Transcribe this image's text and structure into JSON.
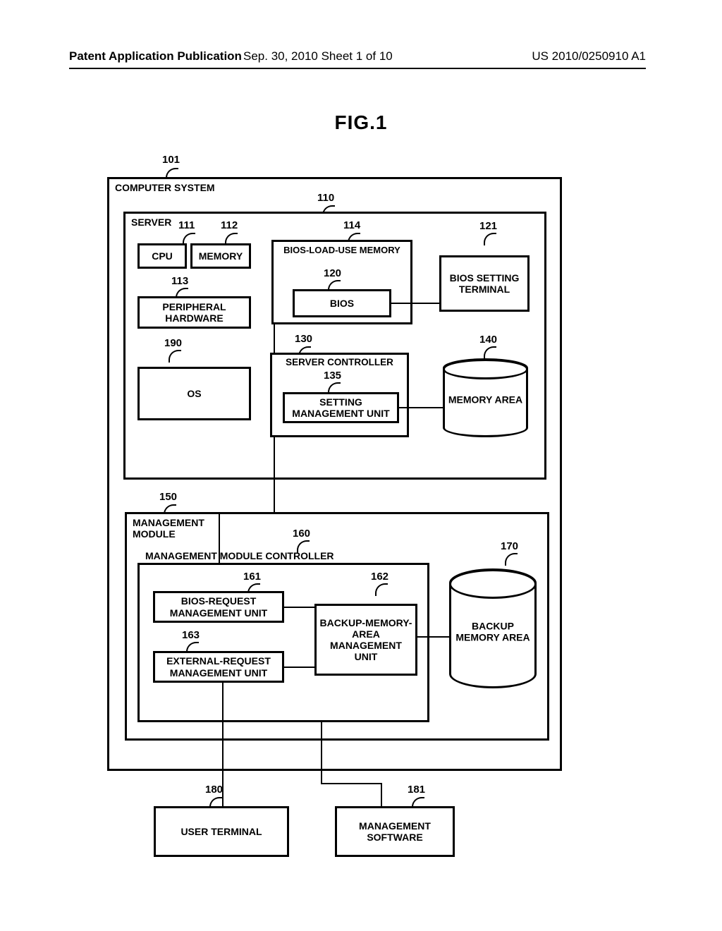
{
  "header": {
    "left": "Patent Application Publication",
    "mid": "Sep. 30, 2010  Sheet 1 of 10",
    "right": "US 2010/0250910 A1"
  },
  "figure_title": "FIG.1",
  "refs": {
    "r101": "101",
    "r110": "110",
    "r111": "111",
    "r112": "112",
    "r113": "113",
    "r114": "114",
    "r120": "120",
    "r121": "121",
    "r130": "130",
    "r135": "135",
    "r140": "140",
    "r150": "150",
    "r160": "160",
    "r161": "161",
    "r162": "162",
    "r163": "163",
    "r170": "170",
    "r180": "180",
    "r181": "181",
    "r190": "190"
  },
  "labels": {
    "computer_system": "COMPUTER SYSTEM",
    "server": "SERVER",
    "cpu": "CPU",
    "memory": "MEMORY",
    "peripheral_hw": "PERIPHERAL HARDWARE",
    "os": "OS",
    "bios_load_mem": "BIOS-LOAD-USE MEMORY",
    "bios": "BIOS",
    "bios_setting_terminal": "BIOS SETTING TERMINAL",
    "server_controller": "SERVER CONTROLLER",
    "setting_mgmt": "SETTING MANAGEMENT UNIT",
    "memory_area": "MEMORY AREA",
    "mgmt_module": "MANAGEMENT MODULE",
    "mmc": "MANAGEMENT MODULE CONTROLLER",
    "bios_req_mgmt": "BIOS-REQUEST MANAGEMENT UNIT",
    "ext_req_mgmt": "EXTERNAL-REQUEST MANAGEMENT UNIT",
    "backup_mem_mgmt": "BACKUP-MEMORY-AREA MANAGEMENT UNIT",
    "backup_mem_area": "BACKUP MEMORY AREA",
    "user_terminal": "USER TERMINAL",
    "mgmt_software": "MANAGEMENT SOFTWARE"
  }
}
